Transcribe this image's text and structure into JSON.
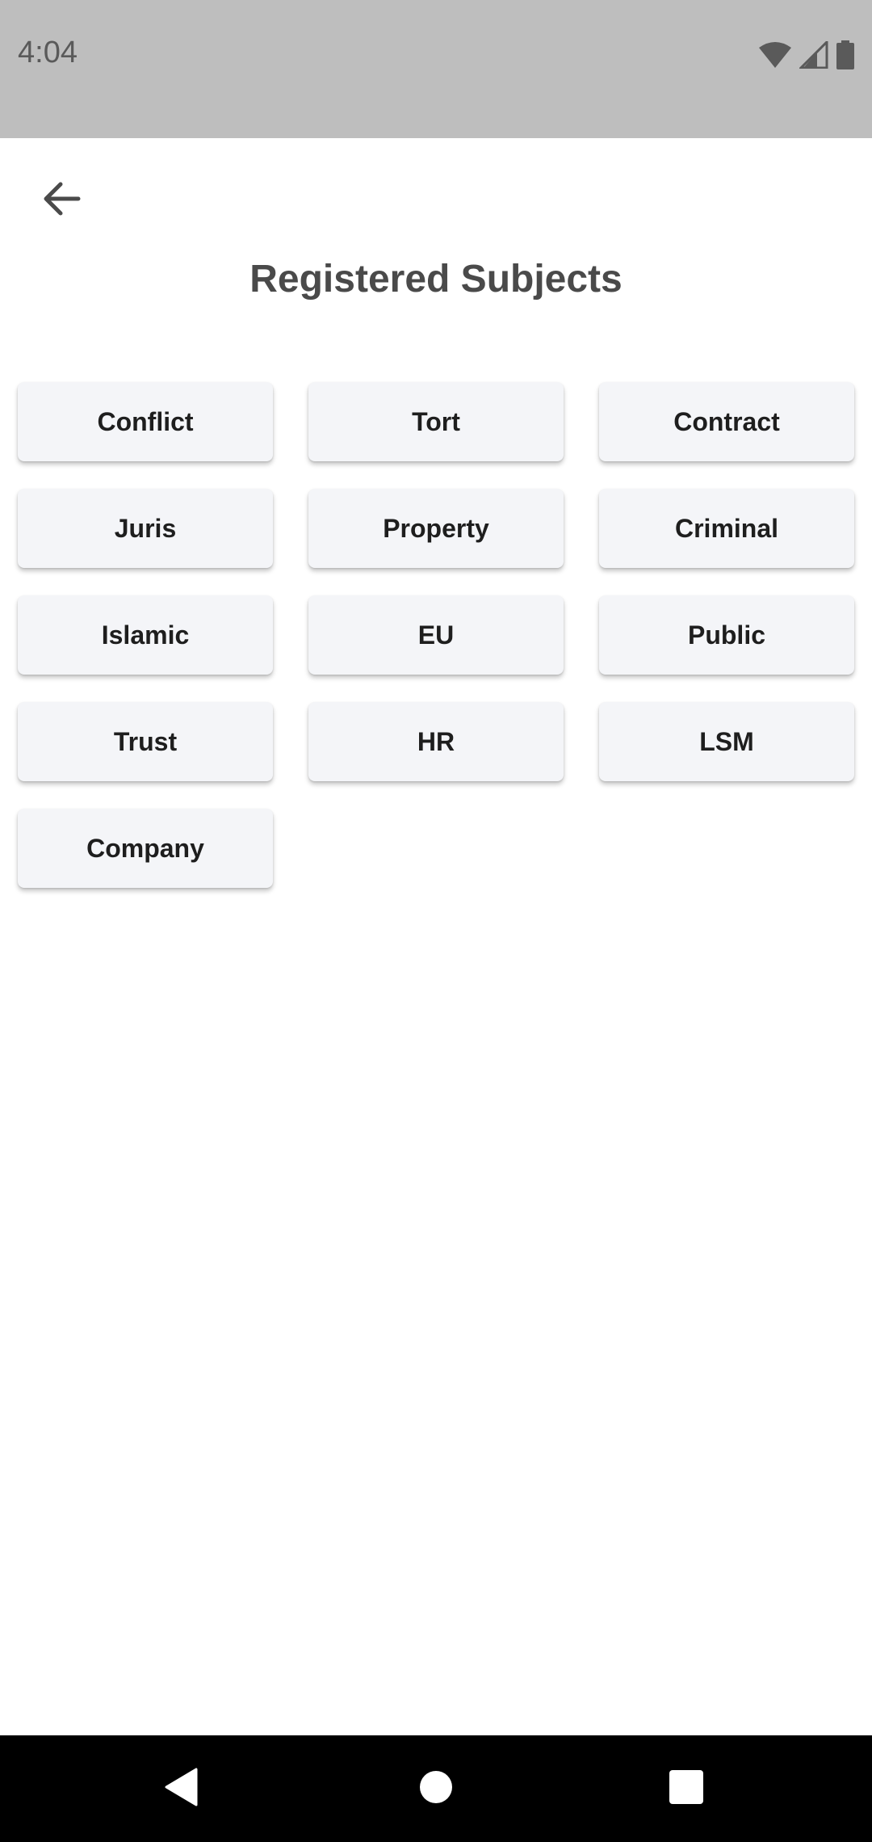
{
  "status_bar": {
    "time": "4:04"
  },
  "header": {
    "back_icon": "arrow-left-icon",
    "title": "Registered Subjects"
  },
  "subjects": [
    {
      "label": "Conflict"
    },
    {
      "label": "Tort"
    },
    {
      "label": "Contract"
    },
    {
      "label": "Juris"
    },
    {
      "label": "Property"
    },
    {
      "label": "Criminal"
    },
    {
      "label": "Islamic"
    },
    {
      "label": "EU"
    },
    {
      "label": "Public"
    },
    {
      "label": "Trust"
    },
    {
      "label": "HR"
    },
    {
      "label": "LSM"
    },
    {
      "label": "Company"
    }
  ],
  "navigation_bar": {
    "back_icon": "triangle-back-icon",
    "home_icon": "circle-home-icon",
    "recents_icon": "square-recents-icon"
  },
  "colors": {
    "status_bar_bg": "#bebebe",
    "button_bg": "#f4f5f8",
    "title_text": "#4a4a4a",
    "nav_bar_bg": "#000000"
  }
}
